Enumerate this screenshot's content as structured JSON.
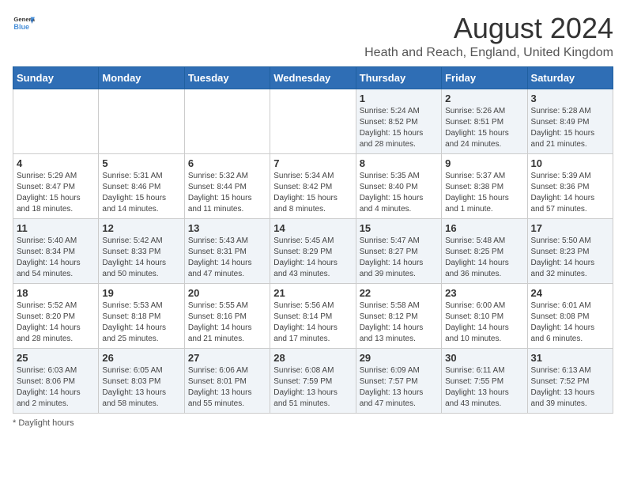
{
  "header": {
    "logo_general": "General",
    "logo_blue": "Blue",
    "main_title": "August 2024",
    "sub_title": "Heath and Reach, England, United Kingdom"
  },
  "footer": {
    "note": "Daylight hours"
  },
  "calendar": {
    "days_of_week": [
      "Sunday",
      "Monday",
      "Tuesday",
      "Wednesday",
      "Thursday",
      "Friday",
      "Saturday"
    ],
    "weeks": [
      [
        {
          "day": "",
          "sunrise": "",
          "sunset": "",
          "daylight": ""
        },
        {
          "day": "",
          "sunrise": "",
          "sunset": "",
          "daylight": ""
        },
        {
          "day": "",
          "sunrise": "",
          "sunset": "",
          "daylight": ""
        },
        {
          "day": "",
          "sunrise": "",
          "sunset": "",
          "daylight": ""
        },
        {
          "day": "1",
          "sunrise": "Sunrise: 5:24 AM",
          "sunset": "Sunset: 8:52 PM",
          "daylight": "Daylight: 15 hours and 28 minutes."
        },
        {
          "day": "2",
          "sunrise": "Sunrise: 5:26 AM",
          "sunset": "Sunset: 8:51 PM",
          "daylight": "Daylight: 15 hours and 24 minutes."
        },
        {
          "day": "3",
          "sunrise": "Sunrise: 5:28 AM",
          "sunset": "Sunset: 8:49 PM",
          "daylight": "Daylight: 15 hours and 21 minutes."
        }
      ],
      [
        {
          "day": "4",
          "sunrise": "Sunrise: 5:29 AM",
          "sunset": "Sunset: 8:47 PM",
          "daylight": "Daylight: 15 hours and 18 minutes."
        },
        {
          "day": "5",
          "sunrise": "Sunrise: 5:31 AM",
          "sunset": "Sunset: 8:46 PM",
          "daylight": "Daylight: 15 hours and 14 minutes."
        },
        {
          "day": "6",
          "sunrise": "Sunrise: 5:32 AM",
          "sunset": "Sunset: 8:44 PM",
          "daylight": "Daylight: 15 hours and 11 minutes."
        },
        {
          "day": "7",
          "sunrise": "Sunrise: 5:34 AM",
          "sunset": "Sunset: 8:42 PM",
          "daylight": "Daylight: 15 hours and 8 minutes."
        },
        {
          "day": "8",
          "sunrise": "Sunrise: 5:35 AM",
          "sunset": "Sunset: 8:40 PM",
          "daylight": "Daylight: 15 hours and 4 minutes."
        },
        {
          "day": "9",
          "sunrise": "Sunrise: 5:37 AM",
          "sunset": "Sunset: 8:38 PM",
          "daylight": "Daylight: 15 hours and 1 minute."
        },
        {
          "day": "10",
          "sunrise": "Sunrise: 5:39 AM",
          "sunset": "Sunset: 8:36 PM",
          "daylight": "Daylight: 14 hours and 57 minutes."
        }
      ],
      [
        {
          "day": "11",
          "sunrise": "Sunrise: 5:40 AM",
          "sunset": "Sunset: 8:34 PM",
          "daylight": "Daylight: 14 hours and 54 minutes."
        },
        {
          "day": "12",
          "sunrise": "Sunrise: 5:42 AM",
          "sunset": "Sunset: 8:33 PM",
          "daylight": "Daylight: 14 hours and 50 minutes."
        },
        {
          "day": "13",
          "sunrise": "Sunrise: 5:43 AM",
          "sunset": "Sunset: 8:31 PM",
          "daylight": "Daylight: 14 hours and 47 minutes."
        },
        {
          "day": "14",
          "sunrise": "Sunrise: 5:45 AM",
          "sunset": "Sunset: 8:29 PM",
          "daylight": "Daylight: 14 hours and 43 minutes."
        },
        {
          "day": "15",
          "sunrise": "Sunrise: 5:47 AM",
          "sunset": "Sunset: 8:27 PM",
          "daylight": "Daylight: 14 hours and 39 minutes."
        },
        {
          "day": "16",
          "sunrise": "Sunrise: 5:48 AM",
          "sunset": "Sunset: 8:25 PM",
          "daylight": "Daylight: 14 hours and 36 minutes."
        },
        {
          "day": "17",
          "sunrise": "Sunrise: 5:50 AM",
          "sunset": "Sunset: 8:23 PM",
          "daylight": "Daylight: 14 hours and 32 minutes."
        }
      ],
      [
        {
          "day": "18",
          "sunrise": "Sunrise: 5:52 AM",
          "sunset": "Sunset: 8:20 PM",
          "daylight": "Daylight: 14 hours and 28 minutes."
        },
        {
          "day": "19",
          "sunrise": "Sunrise: 5:53 AM",
          "sunset": "Sunset: 8:18 PM",
          "daylight": "Daylight: 14 hours and 25 minutes."
        },
        {
          "day": "20",
          "sunrise": "Sunrise: 5:55 AM",
          "sunset": "Sunset: 8:16 PM",
          "daylight": "Daylight: 14 hours and 21 minutes."
        },
        {
          "day": "21",
          "sunrise": "Sunrise: 5:56 AM",
          "sunset": "Sunset: 8:14 PM",
          "daylight": "Daylight: 14 hours and 17 minutes."
        },
        {
          "day": "22",
          "sunrise": "Sunrise: 5:58 AM",
          "sunset": "Sunset: 8:12 PM",
          "daylight": "Daylight: 14 hours and 13 minutes."
        },
        {
          "day": "23",
          "sunrise": "Sunrise: 6:00 AM",
          "sunset": "Sunset: 8:10 PM",
          "daylight": "Daylight: 14 hours and 10 minutes."
        },
        {
          "day": "24",
          "sunrise": "Sunrise: 6:01 AM",
          "sunset": "Sunset: 8:08 PM",
          "daylight": "Daylight: 14 hours and 6 minutes."
        }
      ],
      [
        {
          "day": "25",
          "sunrise": "Sunrise: 6:03 AM",
          "sunset": "Sunset: 8:06 PM",
          "daylight": "Daylight: 14 hours and 2 minutes."
        },
        {
          "day": "26",
          "sunrise": "Sunrise: 6:05 AM",
          "sunset": "Sunset: 8:03 PM",
          "daylight": "Daylight: 13 hours and 58 minutes."
        },
        {
          "day": "27",
          "sunrise": "Sunrise: 6:06 AM",
          "sunset": "Sunset: 8:01 PM",
          "daylight": "Daylight: 13 hours and 55 minutes."
        },
        {
          "day": "28",
          "sunrise": "Sunrise: 6:08 AM",
          "sunset": "Sunset: 7:59 PM",
          "daylight": "Daylight: 13 hours and 51 minutes."
        },
        {
          "day": "29",
          "sunrise": "Sunrise: 6:09 AM",
          "sunset": "Sunset: 7:57 PM",
          "daylight": "Daylight: 13 hours and 47 minutes."
        },
        {
          "day": "30",
          "sunrise": "Sunrise: 6:11 AM",
          "sunset": "Sunset: 7:55 PM",
          "daylight": "Daylight: 13 hours and 43 minutes."
        },
        {
          "day": "31",
          "sunrise": "Sunrise: 6:13 AM",
          "sunset": "Sunset: 7:52 PM",
          "daylight": "Daylight: 13 hours and 39 minutes."
        }
      ]
    ]
  }
}
